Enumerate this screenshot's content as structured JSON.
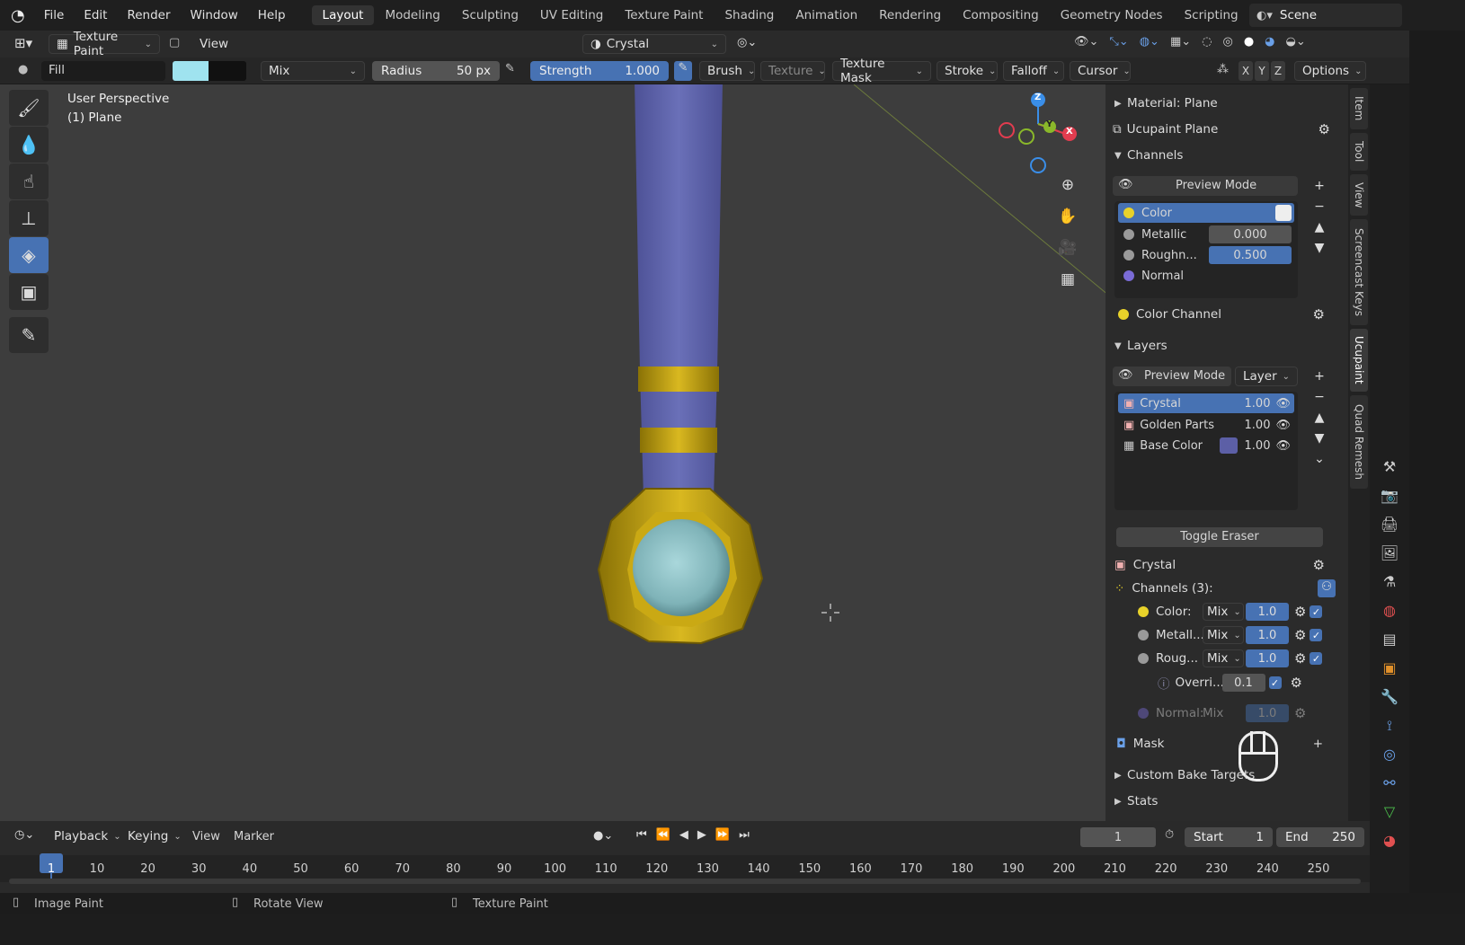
{
  "topbar": {
    "menus": [
      "File",
      "Edit",
      "Render",
      "Window",
      "Help"
    ],
    "workspaces": [
      "Layout",
      "Modeling",
      "Sculpting",
      "UV Editing",
      "Texture Paint",
      "Shading",
      "Animation",
      "Rendering",
      "Compositing",
      "Geometry Nodes",
      "Scripting"
    ],
    "active_workspace": "Layout",
    "scene": "Scene"
  },
  "header": {
    "mode": "Texture Paint",
    "view": "View",
    "material_slot": "Crystal"
  },
  "toolheader": {
    "brush_name": "Fill",
    "color_primary": "#9fe3ef",
    "color_secondary": "#111111",
    "blend": "Mix",
    "radius_label": "Radius",
    "radius_value": "50 px",
    "strength_label": "Strength",
    "strength_value": "1.000",
    "brush": "Brush",
    "texture": "Texture",
    "texture_mask": "Texture Mask",
    "stroke": "Stroke",
    "falloff": "Falloff",
    "cursor": "Cursor",
    "x": "X",
    "y": "Y",
    "z": "Z",
    "options": "Options"
  },
  "viewport": {
    "perspective": "User Perspective",
    "object": "(1) Plane",
    "gizmo": {
      "x": "X",
      "y": "Y",
      "z": "Z"
    }
  },
  "npanel": {
    "material": "Material: Plane",
    "ucupaint": "Ucupaint Plane",
    "channels_header": "Channels",
    "preview_mode": "Preview Mode",
    "channels": [
      {
        "name": "Color",
        "value": "",
        "color": "#e8d22a"
      },
      {
        "name": "Metallic",
        "value": "0.000",
        "color": "#9a9a9a"
      },
      {
        "name": "Roughn...",
        "value": "0.500",
        "color": "#9a9a9a"
      },
      {
        "name": "Normal",
        "value": "",
        "color": "#7a6bd6"
      }
    ],
    "color_channel": "Color Channel",
    "layers_header": "Layers",
    "layers_preview": "Preview Mode",
    "layers_mode": "Layer",
    "layers": [
      {
        "name": "Crystal",
        "value": "1.00"
      },
      {
        "name": "Golden Parts",
        "value": "1.00"
      },
      {
        "name": "Base Color",
        "value": "1.00"
      }
    ],
    "toggle_eraser": "Toggle Eraser",
    "active_layer": "Crystal",
    "channels_count": "Channels (3):",
    "layer_channels": [
      {
        "name": "Color:",
        "blend": "Mix",
        "value": "1.0"
      },
      {
        "name": "Metall...",
        "blend": "Mix",
        "value": "1.0"
      },
      {
        "name": "Roug...",
        "blend": "Mix",
        "value": "1.0"
      }
    ],
    "override": {
      "name": "Overri...",
      "value": "0.1"
    },
    "normal_channel": {
      "name": "Normal:",
      "blend": "Mix",
      "value": "1.0"
    },
    "mask": "Mask",
    "custom_bake": "Custom Bake Targets",
    "stats": "Stats"
  },
  "sidetabs": [
    "Item",
    "Tool",
    "View",
    "Screencast Keys",
    "Ucupaint",
    "Quad Remesh"
  ],
  "timeline": {
    "playback": "Playback",
    "keying": "Keying",
    "view": "View",
    "marker": "Marker",
    "current_frame": "1",
    "start_label": "Start",
    "start": "1",
    "end_label": "End",
    "end": "250",
    "ticks": [
      "1",
      "10",
      "20",
      "30",
      "40",
      "50",
      "60",
      "70",
      "80",
      "90",
      "100",
      "110",
      "120",
      "130",
      "140",
      "150",
      "160",
      "170",
      "180",
      "190",
      "200",
      "210",
      "220",
      "230",
      "240",
      "250"
    ]
  },
  "statusbar": {
    "left": "Image Paint",
    "middle": "Rotate View",
    "right": "Texture Paint"
  },
  "colors": {
    "accent": "#4772b3",
    "viewport_bg": "#3d3d3d",
    "panel_bg": "#2b2b2b",
    "shaft": "#5d62a8",
    "gold": "#c6a712",
    "crystal": "#8fc3c8"
  }
}
